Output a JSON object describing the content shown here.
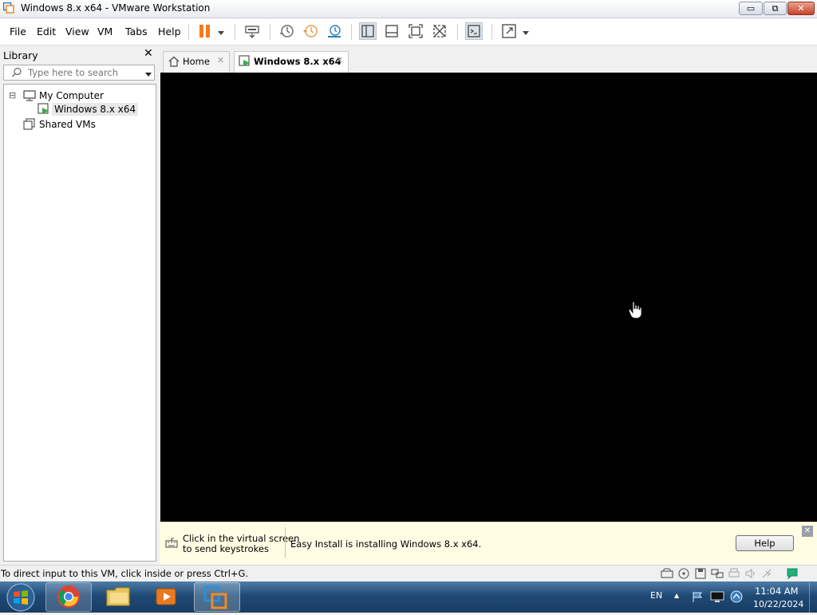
{
  "window": {
    "title": "Windows 8.x x64 - VMware Workstation",
    "min_glyph": "▭",
    "max_glyph": "⧉",
    "close_glyph": "✕"
  },
  "menu": {
    "items": [
      "File",
      "Edit",
      "View",
      "VM",
      "Tabs",
      "Help"
    ]
  },
  "toolbar": {
    "icons": [
      "pause-icon",
      "dropdown-arrow-icon",
      "send-ctrl-alt-del-icon",
      "snapshot-icon",
      "revert-snapshot-icon",
      "snapshot-manager-icon",
      "library-view-icon",
      "thumbnail-bar-icon",
      "full-screen-icon",
      "unity-icon",
      "console-view-icon",
      "stretch-guest-icon",
      "dropdown-arrow-icon"
    ]
  },
  "library": {
    "title": "Library",
    "close_glyph": "✕",
    "search_placeholder": "Type here to search",
    "tree": {
      "my_computer": "My Computer",
      "vm": "Windows 8.x x64",
      "shared": "Shared VMs",
      "expander": "⊟"
    }
  },
  "tabs": {
    "home": "Home",
    "vm": "Windows 8.x x64",
    "close_glyph": "✕"
  },
  "infobar": {
    "click_hint_line1": "Click in the virtual screen",
    "click_hint_line2": "to send keystrokes",
    "message": "Easy Install is installing Windows 8.x x64.",
    "help_label": "Help",
    "close_glyph": "✕"
  },
  "statusbar": {
    "text": "To direct input to this VM, click inside or press Ctrl+G."
  },
  "taskbar": {
    "language": "EN",
    "time": "11:04 AM",
    "date": "10/22/2024",
    "tray_arrow": "▲"
  },
  "colors": {
    "vm_screen": "#000000",
    "infobar_bg": "#fffde3",
    "pause_orange": "#f07c1b",
    "taskbar_blue": "#1f4a75"
  }
}
